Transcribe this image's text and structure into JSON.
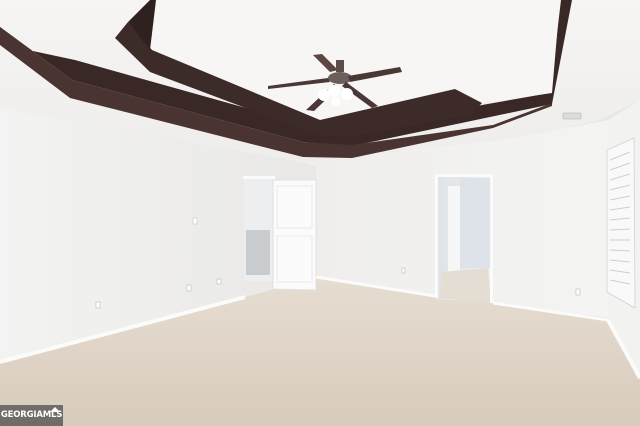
{
  "watermark": {
    "brand_text": "GEORGIAMLS",
    "logo": "house-roof-icon"
  },
  "colors": {
    "wall": "#f1f0ee",
    "ceiling": "#f4f3f1",
    "trim_wood": "#3b2a2a",
    "carpet": "#dcd0c2",
    "baseboard": "#fbfbfa"
  }
}
